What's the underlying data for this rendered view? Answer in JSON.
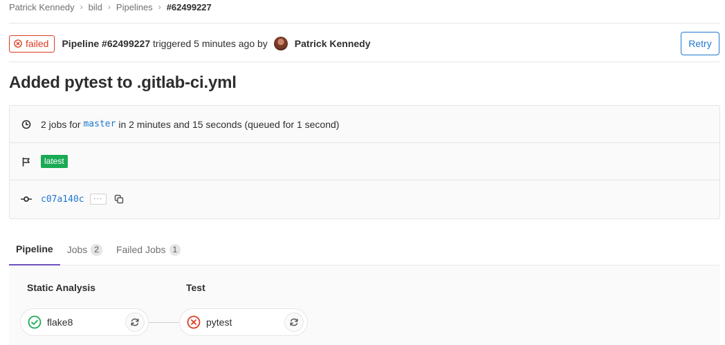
{
  "breadcrumb": [
    "Patrick Kennedy",
    "bild",
    "Pipelines",
    "#62499227"
  ],
  "header": {
    "status": "failed",
    "pipeline_label": "Pipeline #62499227",
    "triggered_text": "triggered 5 minutes ago by",
    "author": "Patrick Kennedy",
    "retry_label": "Retry"
  },
  "commit_title": "Added pytest to .gitlab-ci.yml",
  "info": {
    "jobs_prefix": "2 jobs for",
    "branch": "master",
    "jobs_suffix": "in 2 minutes and 15 seconds (queued for 1 second)",
    "tag": "latest",
    "commit_sha": "c07a140c",
    "more_label": "···"
  },
  "tabs": [
    {
      "label": "Pipeline",
      "count": null
    },
    {
      "label": "Jobs",
      "count": "2"
    },
    {
      "label": "Failed Jobs",
      "count": "1"
    }
  ],
  "stages": [
    {
      "title": "Static Analysis",
      "jobs": [
        {
          "name": "flake8",
          "status": "success"
        }
      ]
    },
    {
      "title": "Test",
      "jobs": [
        {
          "name": "pytest",
          "status": "failed"
        }
      ]
    }
  ],
  "colors": {
    "failed": "#db3b21",
    "success": "#1aaa55",
    "link": "#1f78d1",
    "active_tab": "#6b4fbb"
  }
}
